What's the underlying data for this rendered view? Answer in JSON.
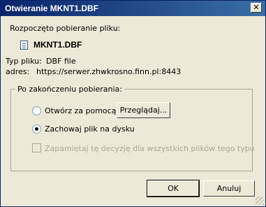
{
  "window": {
    "title": "Otwieranie MKNT1.DBF",
    "close_symbol": "✕"
  },
  "intro": "Rozpoczęto pobieranie pliku:",
  "file": {
    "icon": "dbf-file-icon",
    "name": "MKNT1.DBF",
    "type_label": "Typ pliku:",
    "type_value": "DBF file",
    "address_label": "adres:",
    "address_value": "https://serwer.zhwkrosno.finn.pl:8443"
  },
  "after_download": {
    "legend": "Po zakończeniu pobierania:",
    "open_with_label": "Otwórz za pomocą",
    "browse_button": "Przeglądaj...",
    "save_label": "Zachowaj plik na dysku",
    "selected": "save",
    "remember_label": "Zapamiętaj tę decyzję dla wszystkich plików tego typu",
    "remember_checked": false,
    "remember_enabled": false
  },
  "buttons": {
    "ok": "OK",
    "cancel": "Anuluj"
  }
}
